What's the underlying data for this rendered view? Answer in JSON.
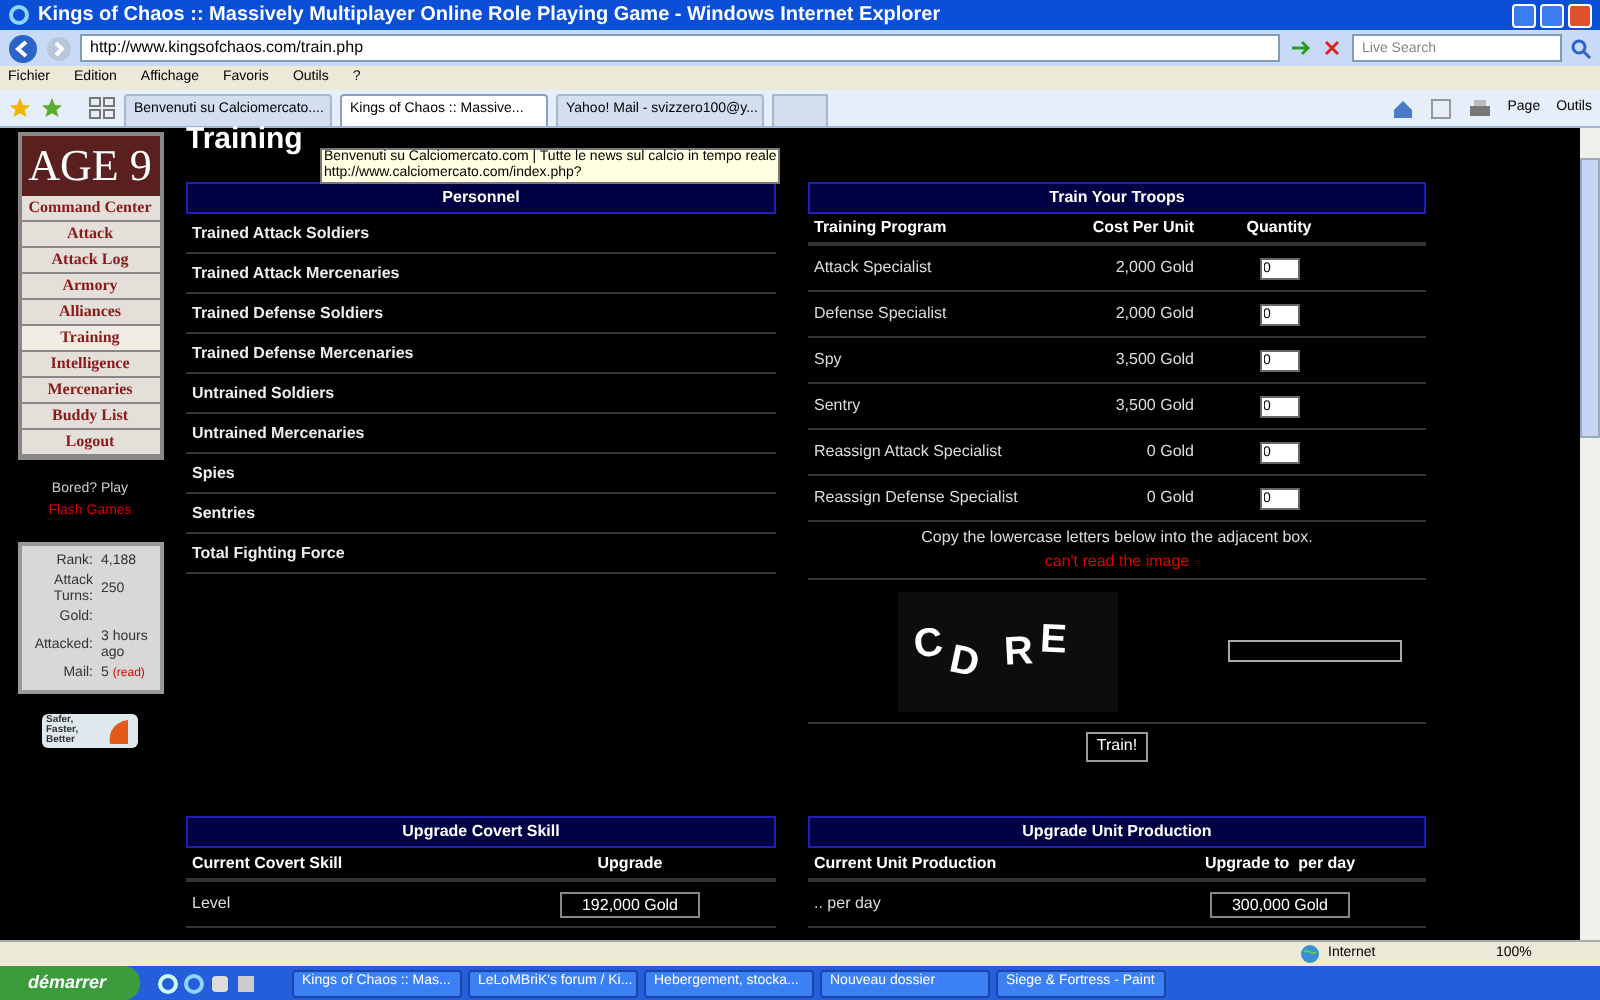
{
  "window": {
    "title": "Kings of Chaos :: Massively Multiplayer Online Role Playing Game - Windows Internet Explorer"
  },
  "address": "http://www.kingsofchaos.com/train.php",
  "search": {
    "placeholder": "Live Search"
  },
  "menu": [
    "Fichier",
    "Edition",
    "Affichage",
    "Favoris",
    "Outils",
    "?"
  ],
  "tabs": [
    {
      "label": "Benvenuti su Calciomercato....",
      "selected": false
    },
    {
      "label": "Kings of Chaos :: Massive...",
      "selected": true
    },
    {
      "label": "Yahoo! Mail - svizzero100@y...",
      "selected": false
    }
  ],
  "toolbar": [
    "Page",
    "Outils"
  ],
  "sidebar": {
    "logo": "AGE 9",
    "items": [
      {
        "label": "Command Center",
        "selected": false
      },
      {
        "label": "Attack",
        "selected": false
      },
      {
        "label": "Attack Log",
        "selected": false
      },
      {
        "label": "Armory",
        "selected": false
      },
      {
        "label": "Alliances",
        "selected": false
      },
      {
        "label": "Training",
        "selected": true
      },
      {
        "label": "Intelligence",
        "selected": false
      },
      {
        "label": "Mercenaries",
        "selected": false
      },
      {
        "label": "Buddy List",
        "selected": false
      },
      {
        "label": "Logout",
        "selected": false
      }
    ],
    "promo": "Bored? Play",
    "promo_link": "Flash Games",
    "stats": [
      {
        "label": "Rank:",
        "value": "4,188"
      },
      {
        "label": "Attack Turns:",
        "value": "250"
      },
      {
        "label": "Gold:"
      },
      {
        "label": "Attacked:",
        "value": "3 hours ago"
      },
      {
        "label": "Mail:",
        "value": "5",
        "link": "(read)"
      }
    ],
    "badge": "Safer, Faster, Better"
  },
  "page_title": "Training",
  "tooltip": {
    "title": "Benvenuti su Calciomercato.com | Tutte le news sul calcio in tempo reale",
    "url": "http://www.calciomercato.com/index.php?"
  },
  "personnel": {
    "title": "Personnel",
    "rows": [
      "Trained Attack Soldiers",
      "Trained Attack Mercenaries",
      "Trained Defense Soldiers",
      "Trained Defense Mercenaries",
      "Untrained Soldiers",
      "Untrained Mercenaries",
      "Spies",
      "Sentries",
      "Total Fighting Force"
    ]
  },
  "train": {
    "title": "Train Your Troops",
    "columns": [
      "Training Program",
      "Cost Per Unit",
      "Quantity"
    ],
    "rows": [
      {
        "program": "Attack Specialist",
        "cost": "2,000 Gold",
        "quantity": "0"
      },
      {
        "program": "Defense Specialist",
        "cost": "2,000 Gold",
        "quantity": "0"
      },
      {
        "program": "Spy",
        "cost": "3,500 Gold",
        "quantity": "0"
      },
      {
        "program": "Sentry",
        "cost": "3,500 Gold",
        "quantity": "0"
      },
      {
        "program": "Reassign Attack Specialist",
        "cost": "0 Gold",
        "quantity": "0"
      },
      {
        "program": "Reassign Defense Specialist",
        "cost": "0 Gold",
        "quantity": "0"
      }
    ],
    "instruction": "Copy the lowercase letters below into the adjacent box.",
    "help_link": "can't read the image",
    "captcha": [
      "C",
      "D",
      "R",
      "E"
    ],
    "button": "Train!"
  },
  "covert": {
    "title": "Upgrade Covert Skill",
    "columns": [
      "Current Covert Skill",
      "Upgrade"
    ],
    "label": "Level",
    "button": "192,000 Gold"
  },
  "production": {
    "title": "Upgrade Unit Production",
    "columns": [
      "Current Unit Production",
      "Upgrade to  per day"
    ],
    "label": ".. per day",
    "button": "300,000 Gold"
  },
  "status_bar": {
    "zone": "Internet",
    "zoom": "100%"
  },
  "taskbar": {
    "start": "démarrer",
    "tasks": [
      "Kings of Chaos :: Mas...",
      "LeLoMBriK's forum / Ki...",
      "Hebergement, stocka...",
      "Nouveau dossier",
      "Siege & Fortress - Paint"
    ]
  }
}
